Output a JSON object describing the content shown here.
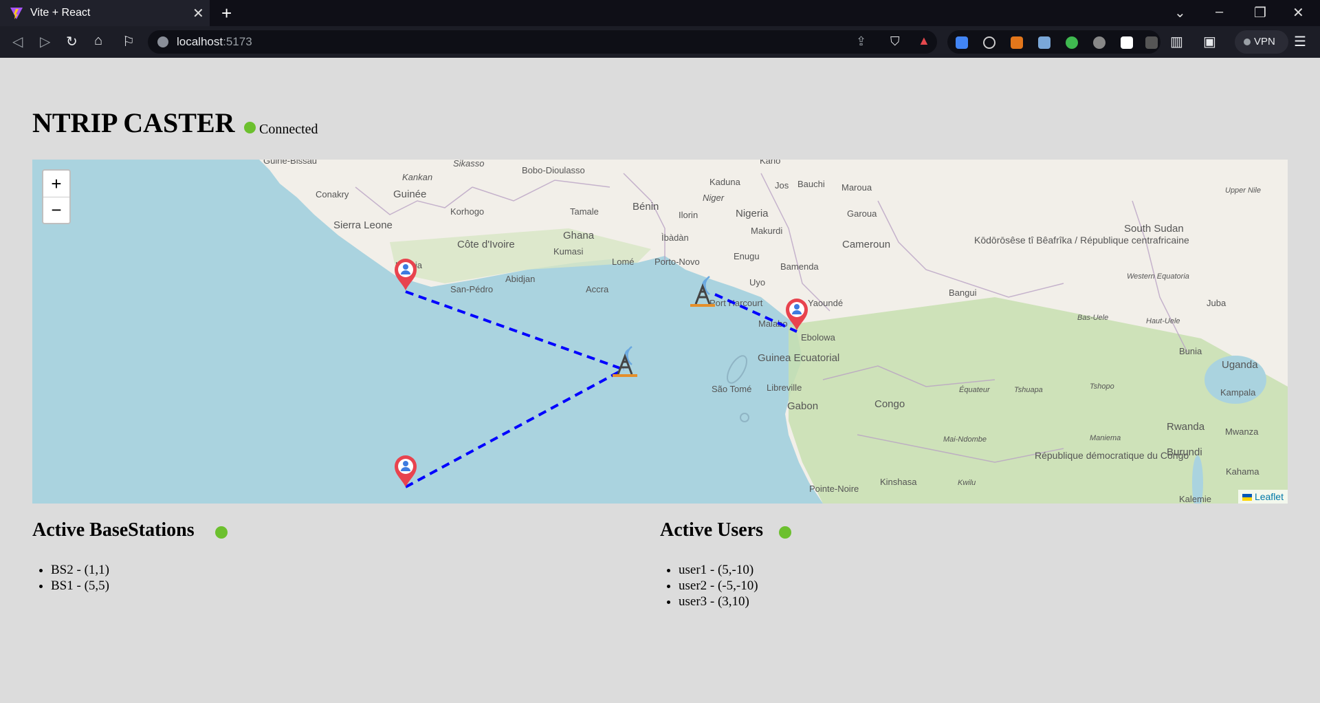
{
  "browser": {
    "tab_title": "Vite + React",
    "url_host": "localhost",
    "url_port": ":5173",
    "vpn_label": "VPN"
  },
  "page": {
    "title": "NTRIP CASTER",
    "status": "Connected",
    "status_color": "#6cc02e"
  },
  "map": {
    "zoom_in": "+",
    "zoom_out": "−",
    "attribution": "Leaflet",
    "link_color": "#0000ff",
    "labels": [
      "Guiné-Bissau",
      "Sikasso",
      "Bobo-Dioulasso",
      "Kano",
      "Kankan",
      "Conakry",
      "Guinée",
      "Kaduna",
      "Jos",
      "Bauchi",
      "Maroua",
      "Korhogo",
      "Tamale",
      "Bénin",
      "Niger",
      "Nigeria",
      "Garoua",
      "Sierra Leone",
      "Ilorin",
      "Makurdi",
      "Côte d'Ivoire",
      "Ghana",
      "Ìbàdàn",
      "Kumasi",
      "Kōdōrōsêse tî Bêafrîka / République centrafricaine",
      "Cameroun",
      "South Sudan",
      "Liberia",
      "Enugu",
      "Lomé",
      "Porto-Novo",
      "Abidjan",
      "Bamenda",
      "San-Pédro",
      "Accra",
      "Uyo",
      "Bangui",
      "Yaoundé",
      "Port Harcourt",
      "Malabo",
      "Ebolowa",
      "Guinea Ecuatorial",
      "São Tomé",
      "Libreville",
      "Gabon",
      "Congo",
      "Juba",
      "Uganda",
      "Kampala",
      "Bunia",
      "Rwanda",
      "Mwanza",
      "Burundi",
      "République démocratique du Congo",
      "Kinshasa",
      "Pointe-Noire",
      "Kalemie",
      "Kahama",
      "Équateur",
      "Tshuapa",
      "Tshopo",
      "Bas-Uele",
      "Haut-Uele",
      "Western Equatoria",
      "Upper Nile",
      "Maniema",
      "Kwilu",
      "Mai-Ndombe"
    ]
  },
  "base_stations": {
    "heading": "Active BaseStations",
    "items": [
      {
        "name": "BS2",
        "coords": "(1,1)",
        "label": "BS2 - (1,1)"
      },
      {
        "name": "BS1",
        "coords": "(5,5)",
        "label": "BS1 - (5,5)"
      }
    ]
  },
  "users": {
    "heading": "Active Users",
    "items": [
      {
        "name": "user1",
        "coords": "(5,-10)",
        "label": "user1 - (5,-10)"
      },
      {
        "name": "user2",
        "coords": "(-5,-10)",
        "label": "user2 - (-5,-10)"
      },
      {
        "name": "user3",
        "coords": "(3,10)",
        "label": "user3 - (3,10)"
      }
    ]
  }
}
